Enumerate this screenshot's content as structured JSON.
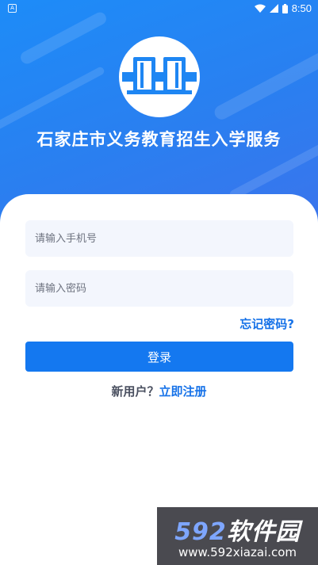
{
  "status_bar": {
    "app_icon_letter": "A",
    "time": "8:50",
    "icons": [
      "wifi-icon",
      "signal-icon",
      "battery-icon"
    ]
  },
  "header": {
    "logo": "book-logo-icon",
    "title": "石家庄市义务教育招生入学服务"
  },
  "login_form": {
    "phone_placeholder": "请输入手机号",
    "phone_value": "",
    "password_placeholder": "请输入密码",
    "password_value": "",
    "forgot_password": "忘记密码?",
    "login_button": "登录",
    "register_prompt": "新用户？",
    "register_link": "立即注册"
  },
  "watermark": {
    "brand_number": "592",
    "brand_text": "软件园",
    "url": "www.592xiazai.com"
  },
  "colors": {
    "header_blue": "#1d8cf8",
    "accent_blue": "#1478f0",
    "link_blue": "#1672e8",
    "input_bg": "#f3f6fd"
  }
}
